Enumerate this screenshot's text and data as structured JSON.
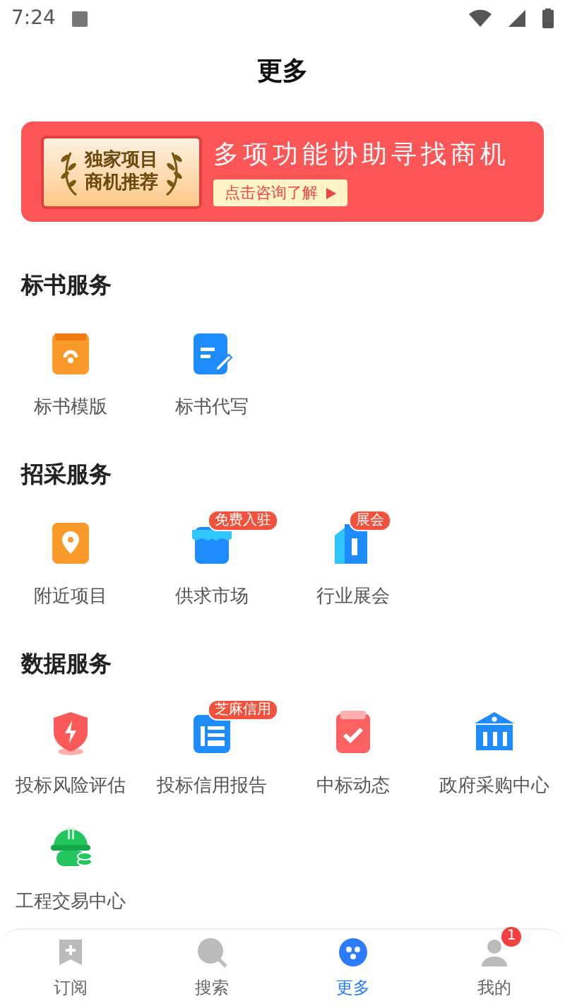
{
  "status_bar": {
    "time": "7:24"
  },
  "header": {
    "title": "更多"
  },
  "banner": {
    "badge_lines": [
      "独家项目",
      "商机推荐"
    ],
    "headline": "多项功能协助寻找商机",
    "button": "点击咨询了解"
  },
  "sections": [
    {
      "title": "标书服务",
      "items": [
        {
          "label": "标书模版"
        },
        {
          "label": "标书代写"
        }
      ]
    },
    {
      "title": "招采服务",
      "items": [
        {
          "label": "附近项目"
        },
        {
          "label": "供求市场",
          "badge": "免费入驻"
        },
        {
          "label": "行业展会",
          "badge": "展会"
        }
      ]
    },
    {
      "title": "数据服务",
      "items": [
        {
          "label": "投标风险评估"
        },
        {
          "label": "投标信用报告",
          "badge": "芝麻信用"
        },
        {
          "label": "中标动态"
        },
        {
          "label": "政府采购中心"
        },
        {
          "label": "工程交易中心"
        }
      ]
    }
  ],
  "tab_bar": [
    {
      "label": "订阅",
      "selected": false
    },
    {
      "label": "搜索",
      "selected": false
    },
    {
      "label": "更多",
      "selected": true
    },
    {
      "label": "我的",
      "selected": false,
      "badge": "1"
    }
  ]
}
